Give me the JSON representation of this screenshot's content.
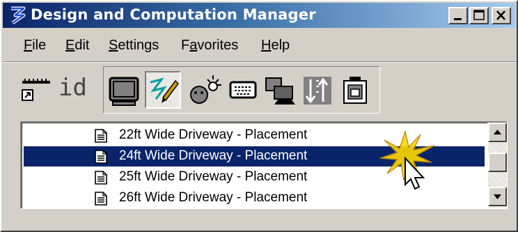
{
  "window": {
    "title": "Design and Computation Manager",
    "icon": "bentley-b-icon",
    "caption_buttons": [
      "minimize",
      "maximize",
      "close"
    ]
  },
  "menubar": {
    "items": [
      {
        "label": "File",
        "underline": "F"
      },
      {
        "label": "Edit",
        "underline": "E"
      },
      {
        "label": "Settings",
        "underline": "S"
      },
      {
        "label": "Favorites",
        "underline": "a"
      },
      {
        "label": "Help",
        "underline": "H"
      }
    ]
  },
  "toolbar": {
    "id_label": "id",
    "tools": [
      {
        "icon": "measure-ruler-icon"
      },
      {
        "icon": "id-text-icon"
      },
      {
        "icon": "monitor-icon"
      },
      {
        "icon": "draw-pen-icon",
        "pressed": true
      },
      {
        "icon": "lightbulb-person-icon"
      },
      {
        "icon": "keyboard-icon"
      },
      {
        "icon": "network-screens-icon"
      },
      {
        "icon": "sort-arrows-icon"
      },
      {
        "icon": "properties-clipboard-icon"
      }
    ]
  },
  "list": {
    "items": [
      {
        "label": "22ft Wide Driveway - Placement",
        "selected": false
      },
      {
        "label": "24ft Wide Driveway - Placement",
        "selected": true
      },
      {
        "label": "25ft Wide Driveway - Placement",
        "selected": false
      },
      {
        "label": "26ft Wide Driveway - Placement",
        "selected": false
      }
    ],
    "item_icon": "document-icon"
  },
  "colors": {
    "title_gradient_start": "#0a246a",
    "title_gradient_end": "#a6caf0",
    "selection": "#0a246a",
    "face": "#d4d0c8"
  }
}
